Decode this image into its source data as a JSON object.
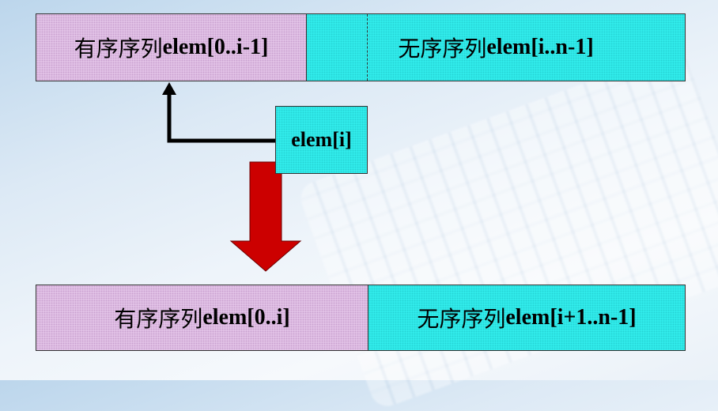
{
  "top": {
    "sorted_cn": "有序序列",
    "sorted_en": "elem[0..i-1]",
    "unsorted_cn": "无序序列",
    "unsorted_en": " elem[i..n-1]"
  },
  "middle": {
    "current": "elem[i]"
  },
  "bottom": {
    "sorted_cn": "有序序列",
    "sorted_en": "elem[0..i]",
    "unsorted_cn": "无序序列",
    "unsorted_en": "elem[i+1..n-1]"
  },
  "colors": {
    "sorted": "#e6c8ea",
    "unsorted": "#33f0ee",
    "arrow_down": "#cc0000",
    "arrow_line": "#000000"
  }
}
